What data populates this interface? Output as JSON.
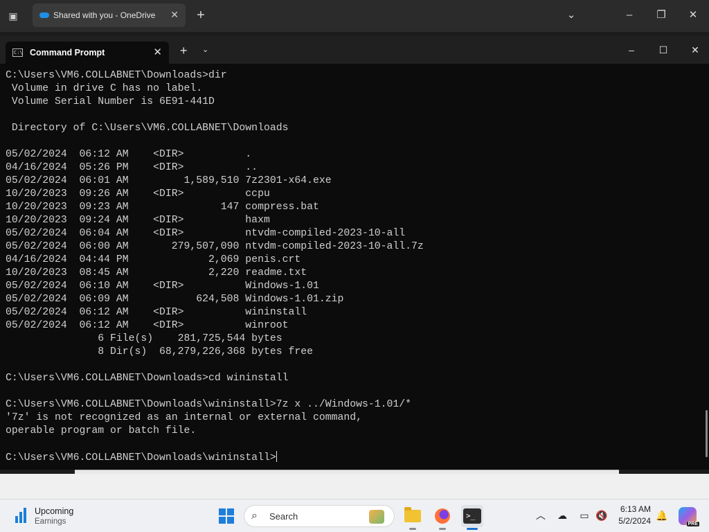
{
  "browser": {
    "tab_title": "Shared with you - OneDrive",
    "icons": [
      "tab-actions-icon",
      "onedrive-icon",
      "close-icon",
      "plus-icon",
      "chevron-down-icon",
      "minimize-icon",
      "restore-icon",
      "close-icon"
    ]
  },
  "terminal": {
    "tab_title": "Command Prompt",
    "tab_icon_text": "C:\\",
    "console_lines": [
      "C:\\Users\\VM6.COLLABNET\\Downloads>dir",
      " Volume in drive C has no label.",
      " Volume Serial Number is 6E91-441D",
      "",
      " Directory of C:\\Users\\VM6.COLLABNET\\Downloads",
      "",
      "05/02/2024  06:12 AM    <DIR>          .",
      "04/16/2024  05:26 PM    <DIR>          ..",
      "05/02/2024  06:01 AM         1,589,510 7z2301-x64.exe",
      "10/20/2023  09:26 AM    <DIR>          ccpu",
      "10/20/2023  09:23 AM               147 compress.bat",
      "10/20/2023  09:24 AM    <DIR>          haxm",
      "05/02/2024  06:04 AM    <DIR>          ntvdm-compiled-2023-10-all",
      "05/02/2024  06:00 AM       279,507,090 ntvdm-compiled-2023-10-all.7z",
      "04/16/2024  04:44 PM             2,069 penis.crt",
      "10/20/2023  08:45 AM             2,220 readme.txt",
      "05/02/2024  06:10 AM    <DIR>          Windows-1.01",
      "05/02/2024  06:09 AM           624,508 Windows-1.01.zip",
      "05/02/2024  06:12 AM    <DIR>          wininstall",
      "05/02/2024  06:12 AM    <DIR>          winroot",
      "               6 File(s)    281,725,544 bytes",
      "               8 Dir(s)  68,279,226,368 bytes free",
      "",
      "C:\\Users\\VM6.COLLABNET\\Downloads>cd wininstall",
      "",
      "C:\\Users\\VM6.COLLABNET\\Downloads\\wininstall>7z x ../Windows-1.01/*",
      "'7z' is not recognized as an internal or external command,",
      "operable program or batch file.",
      ""
    ],
    "prompt": "C:\\Users\\VM6.COLLABNET\\Downloads\\wininstall>",
    "icons": [
      "close-icon",
      "plus-icon",
      "chevron-down-icon",
      "minimize-icon",
      "maximize-icon",
      "close-icon"
    ]
  },
  "taskbar": {
    "widget": {
      "title": "Upcoming",
      "subtitle": "Earnings"
    },
    "search_label": "Search",
    "clock": {
      "time": "6:13 AM",
      "date": "5/2/2024"
    },
    "copilot_badge": "PRE",
    "apps": [
      "file-explorer-icon",
      "firefox-icon",
      "terminal-icon"
    ],
    "tray_icons": [
      "chevron-up-icon",
      "cloud-offline-icon",
      "network-icon",
      "volume-muted-icon",
      "notification-bell-icon"
    ]
  }
}
